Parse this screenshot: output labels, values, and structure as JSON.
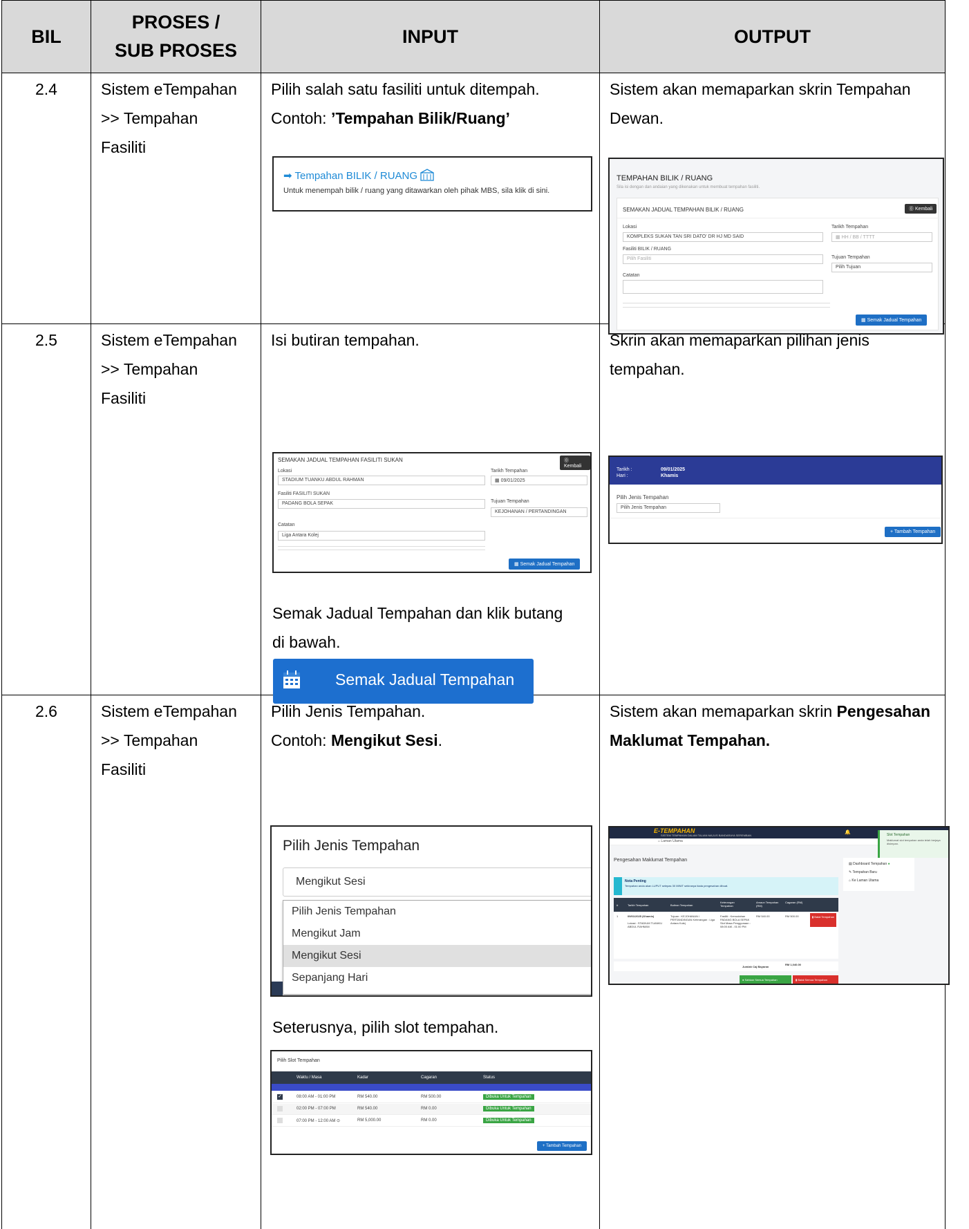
{
  "header": {
    "bil": "BIL",
    "proses_line1": "PROSES /",
    "proses_line2": "SUB PROSES",
    "input": "INPUT",
    "output": "OUTPUT"
  },
  "rows": [
    {
      "bil": "2.4",
      "proses": [
        "Sistem eTempahan",
        ">> Tempahan",
        "Fasiliti"
      ],
      "input_line1": "Pilih salah satu fasiliti untuk ditempah.",
      "input_line2_prefix": "Contoh: ",
      "input_line2_bold": "’Tempahan Bilik/Ruang’",
      "output_line1": "Sistem akan memaparkan skrin Tempahan",
      "output_line2": "Dewan.",
      "input_shot": {
        "link": "Tempahan BILIK / RUANG",
        "desc": "Untuk menempah bilik / ruang yang ditawarkan oleh pihak MBS, sila klik di sini."
      },
      "output_shot": {
        "title": "TEMPAHAN BILIK / RUANG",
        "subtitle": "Sila isi dengan dan andaian yang dikenakan untuk membuat tempahan fasiliti.",
        "section": "SEMAKAN JADUAL TEMPAHAN BILIK / RUANG",
        "back": "Kembali",
        "lokasi_label": "Lokasi",
        "lokasi_value": "KOMPLEKS SUKAN TAN SRI DATO' DR HJ MD SAID",
        "tarikh_label": "Tarikh Tempahan",
        "tarikh_value": "HH / BB / TTTT",
        "fasiliti_label": "Fasiliti BILIK / RUANG",
        "fasiliti_value": "Pilih Fasiliti",
        "tujuan_label": "Tujuan Tempahan",
        "tujuan_value": "Pilih Tujuan",
        "catatan_label": "Catatan",
        "button": "Semak Jadual Tempahan"
      }
    },
    {
      "bil": "2.5",
      "proses": [
        "Sistem eTempahan",
        ">> Tempahan",
        "Fasiliti"
      ],
      "input_line1": "Isi butiran tempahan.",
      "input_after_line1": "Semak Jadual Tempahan dan klik butang",
      "input_after_line2": "di bawah.",
      "big_button": "Semak Jadual Tempahan",
      "output_line1": "Skrin akan memaparkan pilihan jenis",
      "output_line2": "tempahan.",
      "input_shot": {
        "section": "SEMAKAN JADUAL TEMPAHAN FASILITI SUKAN",
        "back": "Kembali",
        "lokasi_label": "Lokasi",
        "lokasi_value": "STADIUM TUANKU ABDUL RAHMAN",
        "tarikh_label": "Tarikh Tempahan",
        "tarikh_value": "09/01/2025",
        "fasiliti_label": "Fasiliti FASILITI SUKAN",
        "fasiliti_value": "PADANG BOLA SEPAK",
        "tujuan_label": "Tujuan Tempahan",
        "tujuan_value": "KEJOHANAN / PERTANDINGAN",
        "catatan_label": "Catatan",
        "catatan_value": "Liga Antara Kolej",
        "button": "Semak Jadual Tempahan"
      },
      "output_shot": {
        "tarikh_label": "Tarikh :",
        "tarikh_value": "09/01/2025",
        "hari_label": "Hari :",
        "hari_value": "Khamis",
        "pilih_label": "Pilih Jenis Tempahan",
        "pilih_value": "Pilih Jenis Tempahan",
        "button": "Tambah Tempahan"
      }
    },
    {
      "bil": "2.6",
      "proses": [
        "Sistem eTempahan",
        ">> Tempahan",
        "Fasiliti"
      ],
      "input_line1": "Pilih Jenis Tempahan.",
      "input_line2_prefix": "Contoh: ",
      "input_line2_bold": "Mengikut Sesi",
      "input_line2_suffix": ".",
      "input_after": "Seterusnya, pilih slot tempahan.",
      "output_line1_prefix": "Sistem akan memaparkan skrin ",
      "output_line1_bold": "Pengesahan",
      "output_line2_bold": "Maklumat Tempahan.",
      "dropdown": {
        "title": "Pilih Jenis Tempahan",
        "selected": "Mengikut Sesi",
        "options": [
          "Pilih Jenis Tempahan",
          "Mengikut Jam",
          "Mengikut Sesi",
          "Sepanjang Hari"
        ]
      },
      "slot_shot": {
        "title": "Pilih Slot Tempahan",
        "headers": [
          "Waktu / Masa",
          "Kadar",
          "Cagaran",
          "Status"
        ],
        "rows": [
          {
            "time": "08:00 AM - 01:00 PM",
            "kadar": "RM 540.00",
            "cagaran": "RM 500.00",
            "status": "Dibuka Untuk Tempahan"
          },
          {
            "time": "02:00 PM - 07:00 PM",
            "kadar": "RM 540.00",
            "cagaran": "RM 0.00",
            "status": "Dibuka Untuk Tempahan"
          },
          {
            "time": "07:00 PM - 12:00 AM",
            "kadar": "RM 5,000.00",
            "cagaran": "RM 0.00",
            "status": "Dibuka Untuk Tempahan"
          }
        ],
        "button": "Tambah Tempahan"
      },
      "output_shot": {
        "brand": "E-TEMPAHAN",
        "brand_sub": "SISTEM TEMPAHAN DALAM TALIAN MAJLIS BANDARAYA SEREMBAN",
        "crumb": "Laman Utama",
        "page_title": "Pengesahan Maklumat Tempahan",
        "toast_title": "Slot Tempahan",
        "toast_msg": "Maklumat slot tempahan anda telah berjaya disimpan.",
        "nota_title": "Nota Penting",
        "nota_msg": "Tempahan anda akan LUPUT selepas 30 MINIT sekiranya tiada pengesahan dibuat.",
        "menu": [
          "Dashboard Tempahan",
          "Tempahan Baru",
          "Ke Laman Utama"
        ],
        "headers": [
          "#",
          "Tarikh Tempahan",
          "Butiran Tempahan",
          "Keterangan Tempahan",
          "Amaun Tempahan (RM)",
          "Cagaran (RM)"
        ],
        "row_date": "09/01/2025 (Khamis)",
        "row_loc": "Lokasi : STADIUM TUANKU ABDUL RAHMAN",
        "row_butiran": "Tujuan : KEJOHANAN / PERTANDINGAN Keterangan : Liga Antara Kolej",
        "row_ket": "Fasiliti : Kemudahan PADANG BOLA SEPAK Slot Masa Penggunaan : 08:00 AM - 01:00 PM",
        "row_amaun": "RM 540.00",
        "row_cagaran": "RM 500.00",
        "row_btn": "Batal Tempahan",
        "jumlah_label": "Jumlah Caj Bayaran",
        "jumlah_value": "RM 1,040.00",
        "btn_ok": "Sahkan Semua Tempahan",
        "btn_cancel": "Batal Semua Tempahan"
      }
    }
  ]
}
